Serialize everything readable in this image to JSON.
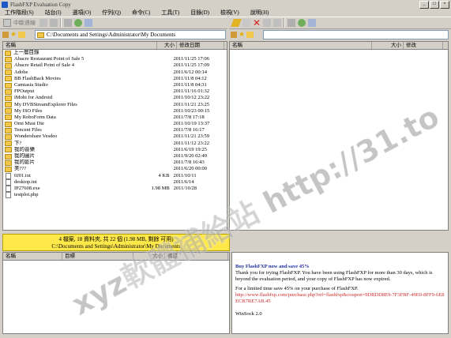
{
  "window": {
    "title": "FlashFXP Evaluation Copy",
    "buttons": [
      "_",
      "□",
      "×"
    ]
  },
  "menu": [
    "工作階段(S)",
    "站台(I)",
    "選項(O)",
    "佇列(Q)",
    "命令(C)",
    "工具(T)",
    "目錄(D)",
    "檢視(V)",
    "說明(H)"
  ],
  "toolbar_left": {
    "connect_label": "中斷連線"
  },
  "left": {
    "path": "C:\\Documents and Settings\\Administrator\\My Documents",
    "headers": [
      "名稱",
      "大小",
      "修改日期"
    ],
    "files": [
      {
        "name": "上一層目錄",
        "size": "",
        "date": "",
        "icon": "up-folder"
      },
      {
        "name": "Abacre Restaurant Point of Sale 5",
        "size": "",
        "date": "2011/11/25 17:06",
        "icon": "folder"
      },
      {
        "name": "Abacre Retail Point of Sale 4",
        "size": "",
        "date": "2011/11/25 17:09",
        "icon": "folder"
      },
      {
        "name": "Adobe",
        "size": "",
        "date": "2011/6/12 00:14",
        "icon": "folder"
      },
      {
        "name": "BB FlashBack Movies",
        "size": "",
        "date": "2011/11/8 04:12",
        "icon": "folder"
      },
      {
        "name": "Camtasia Studio",
        "size": "",
        "date": "2011/11/8 04:31",
        "icon": "folder"
      },
      {
        "name": "FPOutput",
        "size": "",
        "date": "2011/11/16 01:32",
        "icon": "folder"
      },
      {
        "name": "iMobi for Android",
        "size": "",
        "date": "2011/10/12 23:22",
        "icon": "folder"
      },
      {
        "name": "My DVBStreamExplorer Files",
        "size": "",
        "date": "2011/11/21 23:25",
        "icon": "folder"
      },
      {
        "name": "My ISO Files",
        "size": "",
        "date": "2011/10/23 00:15",
        "icon": "folder"
      },
      {
        "name": "My RoboForm Data",
        "size": "",
        "date": "2011/7/8 17:18",
        "icon": "folder"
      },
      {
        "name": "Orni Must Die",
        "size": "",
        "date": "2011/10/19 13:37",
        "icon": "folder"
      },
      {
        "name": "Tencent Files",
        "size": "",
        "date": "2011/7/8 16:17",
        "icon": "folder"
      },
      {
        "name": "Wondershare Vesdeo",
        "size": "",
        "date": "2011/11/21 23:59",
        "icon": "folder"
      },
      {
        "name": "下?",
        "size": "",
        "date": "2011/11/12 23:22",
        "icon": "folder"
      },
      {
        "name": "我的音樂",
        "size": "",
        "date": "2011/6/19 19:25",
        "icon": "folder"
      },
      {
        "name": "我的圖片",
        "size": "",
        "date": "2011/9/20 02:49",
        "icon": "folder"
      },
      {
        "name": "我的影片",
        "size": "",
        "date": "2011/7/8 16:43",
        "icon": "folder"
      },
      {
        "name": "美???",
        "size": "",
        "date": "2011/6/20 00:00",
        "icon": "folder"
      },
      {
        "name": "0J01.txt",
        "size": "4 KB",
        "date": "2011/10/11",
        "icon": "file"
      },
      {
        "name": "desktop.ini",
        "size": "",
        "date": "2011/6/14",
        "icon": "file"
      },
      {
        "name": "IP27608.exe",
        "size": "1.98 MB",
        "date": "2011/10/28",
        "icon": "file"
      },
      {
        "name": "testplot.php",
        "size": "",
        "date": "",
        "icon": "file"
      }
    ],
    "status_line1": "4 檔案, 18 資料夾, 共 22 個 (1.98 MB, 剩餘 可用)",
    "status_line2": "C:\\Documents and Settings\\Administrator\\My Documents"
  },
  "right": {
    "headers": [
      "名稱",
      "大小",
      "修改"
    ]
  },
  "queue": {
    "headers": [
      "名稱",
      "目標",
      "大小",
      "備註"
    ]
  },
  "message": {
    "title": "Buy FlashFXP now and save 45%",
    "body1": "Thank you for trying FlashFXP. You have been using FlashFXP for more than 30 days, which is beyond the evaluation period, and your copy of FlashFXP has now expired.",
    "body2": "For a limited time save 45% on your purchase of FlashFXP.",
    "link": "http://www.flashfxp.com/purchase.php?ref=flashfxp&coupon=9DBDD8E9-7F3FBF-49E0-8FF9-6E8ECB7RE7AB.45",
    "footer": "WinSock 2.0"
  },
  "watermark": "xyz軟體補給站 http://31.to"
}
